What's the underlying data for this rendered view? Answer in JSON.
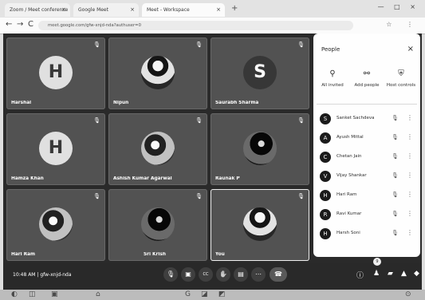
{
  "browser": {
    "tabs": [
      "Zoom / Meet conference",
      "Google Meet",
      "Meet - Workspace"
    ],
    "url": "meet.google.com/gfw-xnjd-nda?authuser=0",
    "window_controls": "— □ ×",
    "new_tab": "+",
    "nav": {
      "back": "←",
      "forward": "→",
      "reload": "C"
    },
    "toolbar_icons": "☆ ⋮"
  },
  "tiles": [
    {
      "name": "Harshal",
      "avatar": {
        "type": "initial",
        "value": "H",
        "tone": "light"
      }
    },
    {
      "name": "Nipun",
      "avatar": {
        "type": "photo",
        "value": "",
        "tone": "light"
      }
    },
    {
      "name": "Saurabh Sharma",
      "avatar": {
        "type": "initial",
        "value": "S",
        "tone": "dark"
      }
    },
    {
      "name": "Hamza Khan",
      "avatar": {
        "type": "initial",
        "value": "H",
        "tone": "light"
      }
    },
    {
      "name": "Ashish Kumar Agarwal",
      "avatar": {
        "type": "photo",
        "value": "",
        "tone": "alt"
      }
    },
    {
      "name": "Raunak P",
      "avatar": {
        "type": "photo",
        "value": "",
        "tone": "dark"
      }
    },
    {
      "name": "Hari Ram",
      "avatar": {
        "type": "photo",
        "value": "",
        "tone": "alt"
      }
    },
    {
      "name": "Sri Krish",
      "avatar": {
        "type": "photo",
        "value": "",
        "tone": "dark"
      }
    },
    {
      "name": "You",
      "avatar": {
        "type": "photo",
        "value": "",
        "tone": "light"
      },
      "selected": true
    }
  ],
  "people_panel": {
    "title": "People",
    "close": "×",
    "actions": [
      {
        "label": "All invited",
        "icon": "person-add-icon",
        "glyph": "⚲"
      },
      {
        "label": "Add people",
        "icon": "person-add-icon",
        "glyph": "⚯"
      },
      {
        "label": "Host controls",
        "icon": "shield-icon",
        "glyph": "⛨"
      }
    ],
    "participants": [
      {
        "name": "Sanket Sachdeva",
        "initial": "S"
      },
      {
        "name": "Ayush Mittal",
        "initial": "A"
      },
      {
        "name": "Chetan Jain",
        "initial": "C"
      },
      {
        "name": "Vijay Shankar",
        "initial": "V"
      },
      {
        "name": "Hari Ram",
        "initial": "H"
      },
      {
        "name": "Ravi Kumar",
        "initial": "R"
      },
      {
        "name": "Harsh Soni",
        "initial": "H"
      }
    ],
    "mic_glyph": "🎙",
    "more_glyph": "⋮"
  },
  "bottom_bar": {
    "time": "10:48 AM",
    "meeting_code": "gfw-xnjd-nda",
    "controls": [
      {
        "icon": "mic-icon",
        "glyph": "🎙"
      },
      {
        "icon": "video-icon",
        "glyph": "▣"
      },
      {
        "icon": "captions-icon",
        "glyph": "CC"
      },
      {
        "icon": "raise-hand-icon",
        "glyph": "✋"
      },
      {
        "icon": "present-icon",
        "glyph": "▤"
      },
      {
        "icon": "more-icon",
        "glyph": "⋯"
      },
      {
        "icon": "end-call-icon",
        "glyph": "☎"
      }
    ],
    "right_controls": [
      {
        "icon": "info-icon",
        "glyph": "ⓘ"
      },
      {
        "icon": "people-icon",
        "glyph": "♟"
      },
      {
        "icon": "chat-icon",
        "glyph": "▰"
      },
      {
        "icon": "activities-icon",
        "glyph": "▲"
      },
      {
        "icon": "lock-icon",
        "glyph": "◆"
      }
    ],
    "badge": "9"
  },
  "taskbar": {
    "icons": [
      "◐",
      "◫",
      "▣",
      "⌂",
      "G",
      "◪",
      "◩",
      "⊙"
    ]
  }
}
